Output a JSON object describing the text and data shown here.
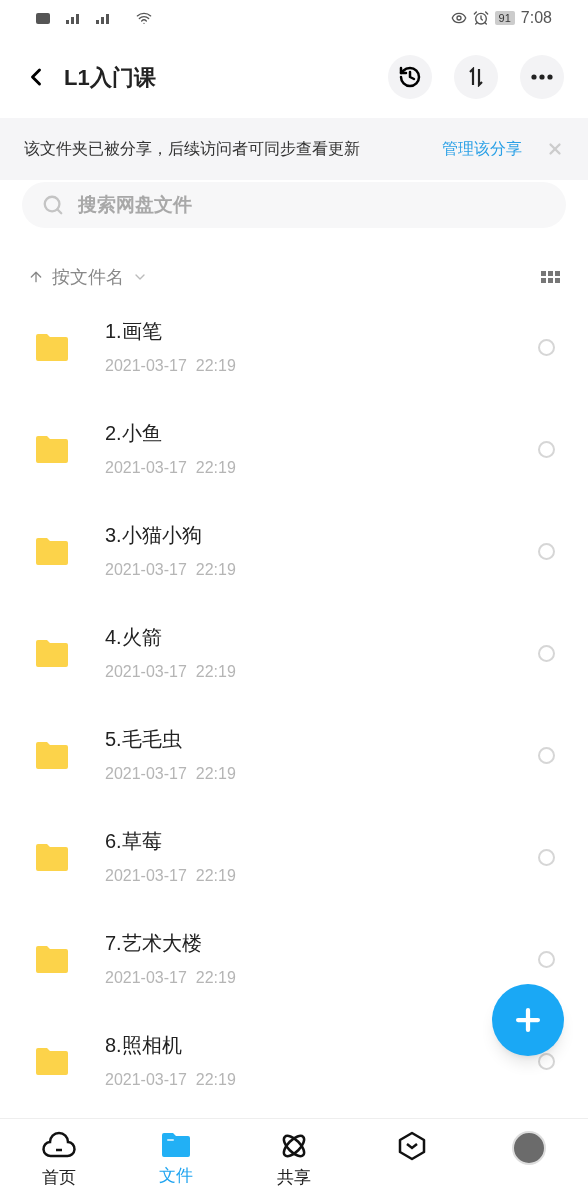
{
  "status_bar": {
    "time": "7:08",
    "battery": "91"
  },
  "header": {
    "title": "L1入门课"
  },
  "share_notice": {
    "text": "该文件夹已被分享，后续访问者可同步查看更新",
    "link": "管理该分享"
  },
  "search": {
    "placeholder": "搜索网盘文件"
  },
  "sort": {
    "label": "按文件名"
  },
  "files": [
    {
      "name": "1.画笔",
      "date": "2021-03-17  22:19",
      "selected": false
    },
    {
      "name": "2.小鱼",
      "date": "2021-03-17  22:19",
      "selected": false
    },
    {
      "name": "3.小猫小狗",
      "date": "2021-03-17  22:19",
      "selected": false
    },
    {
      "name": "4.火箭",
      "date": "2021-03-17  22:19",
      "selected": false
    },
    {
      "name": "5.毛毛虫",
      "date": "2021-03-17  22:19",
      "selected": false
    },
    {
      "name": "6.草莓",
      "date": "2021-03-17  22:19",
      "selected": false
    },
    {
      "name": "7.艺术大楼",
      "date": "2021-03-17  22:19",
      "selected": false
    },
    {
      "name": "8.照相机",
      "date": "2021-03-17  22:19",
      "selected": false
    }
  ],
  "tabs": [
    {
      "kind": "home",
      "label": "首页",
      "selected": false
    },
    {
      "kind": "files",
      "label": "文件",
      "selected": true
    },
    {
      "kind": "share",
      "label": "共享",
      "selected": false
    },
    {
      "kind": "discover",
      "selected": false
    },
    {
      "kind": "profile",
      "selected": false
    }
  ]
}
